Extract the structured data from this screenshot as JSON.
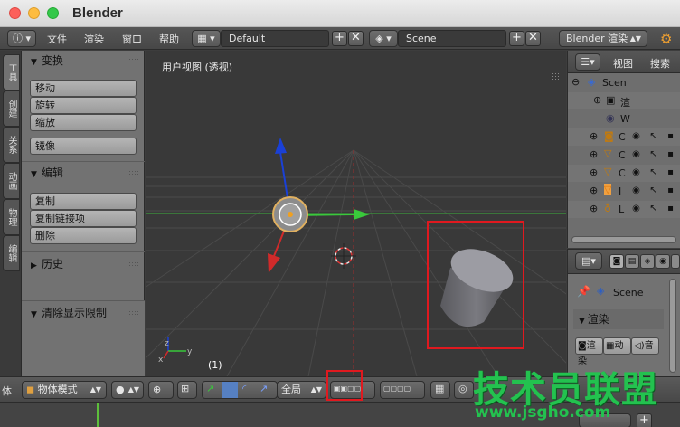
{
  "window": {
    "title": "Blender"
  },
  "menu": {
    "items": [
      "文件",
      "渲染",
      "窗口",
      "帮助"
    ]
  },
  "screen_layout": {
    "value": "Default"
  },
  "scene_field": {
    "value": "Scene"
  },
  "render_engine": {
    "value": "Blender 渲染"
  },
  "tool_tabs": [
    "工具",
    "创建",
    "关系",
    "动画",
    "物理",
    "编辑"
  ],
  "toolshelf": {
    "transform": {
      "title": "变换",
      "buttons": [
        "移动",
        "旋转",
        "缩放",
        "镜像"
      ]
    },
    "edit": {
      "title": "编辑",
      "buttons": [
        "复制",
        "复制链接项",
        "删除"
      ]
    },
    "history": {
      "title": "历史"
    },
    "clear_limits": {
      "title": "清除显示限制"
    }
  },
  "viewport": {
    "label": "用户视图 (透视)",
    "frame": "(1)"
  },
  "outliner": {
    "view_label": "视图",
    "search_label": "搜索",
    "rows": [
      "Scen",
      "渲",
      "W",
      "C",
      "C",
      "C",
      "I",
      "L"
    ]
  },
  "properties": {
    "scene_label": "Scene",
    "render_panel": "渲染",
    "buttons": [
      "渲染",
      "动",
      "音"
    ]
  },
  "bottom_header": {
    "mode": "物体模式",
    "orientation": "全局",
    "left_edge_label": "体"
  },
  "watermark": {
    "line1": "技术员联盟",
    "line2": "www.jsgho.com"
  },
  "colors": {
    "x_axis": "#39c93b",
    "y_axis": "#d12a2a",
    "z_axis": "#1a40d6",
    "highlight": "#e0191f",
    "watermark": "#23c24f"
  }
}
